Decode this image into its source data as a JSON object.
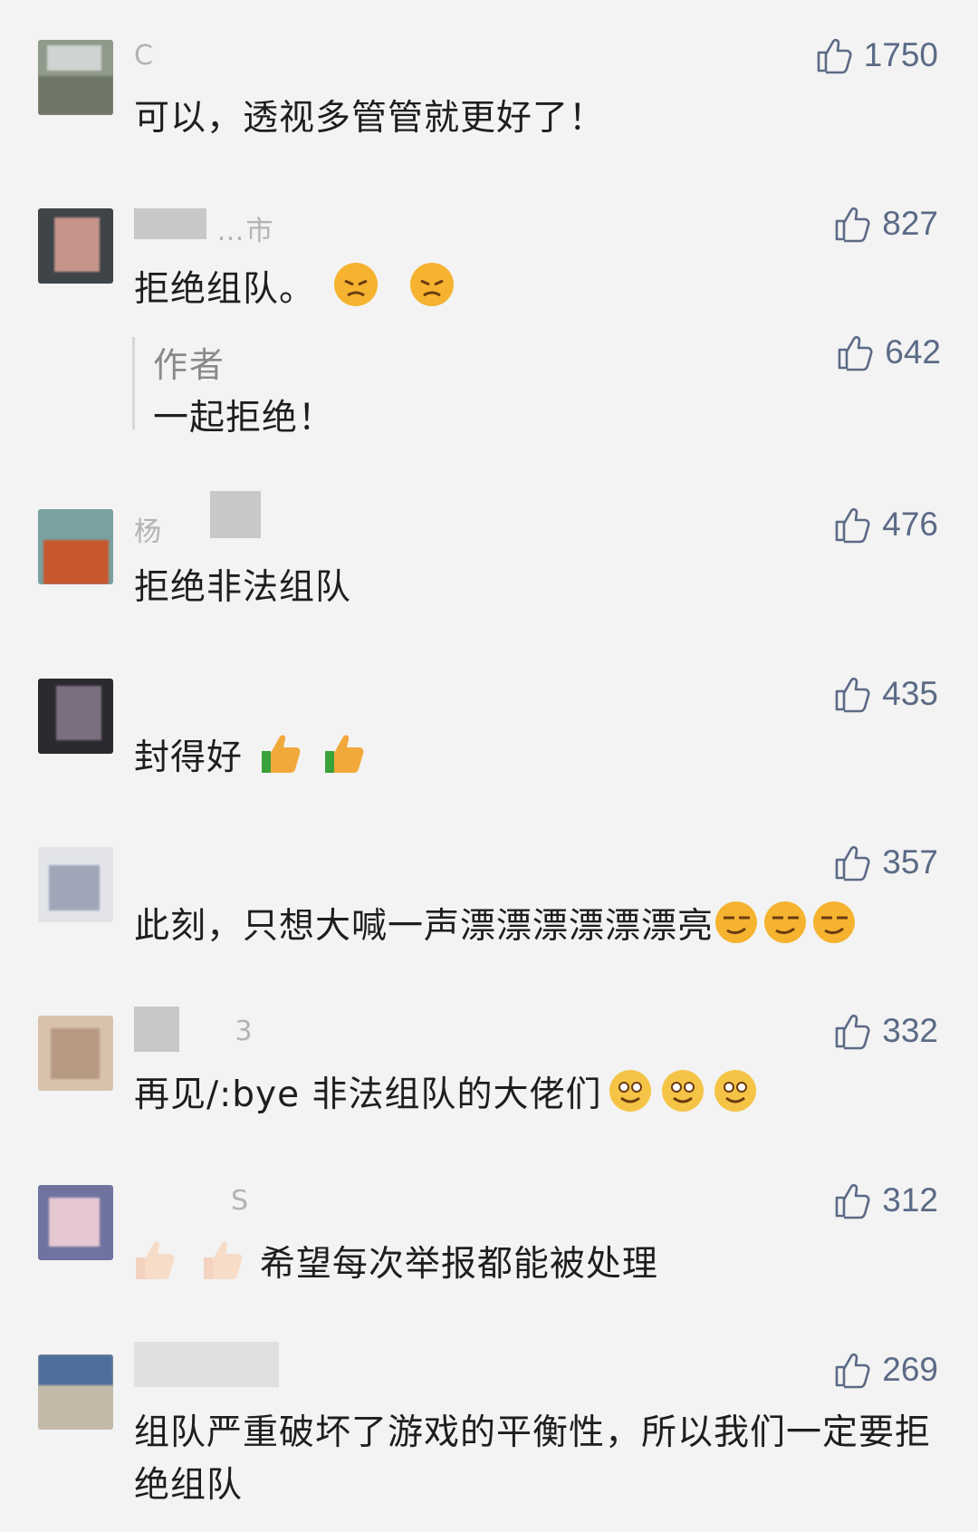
{
  "theme": {
    "background": "#f3f3f3",
    "like_color": "#5b6a86",
    "text_color": "#1e1e1e",
    "name_color": "#b3b3b3"
  },
  "comments": [
    {
      "name": "C",
      "text": "可以，透视多管管就更好了！",
      "likes": "1750",
      "emojis": []
    },
    {
      "name": "…市",
      "text": "拒绝组队。",
      "likes": "827",
      "emojis": [
        "angry-emoji",
        "angry-emoji"
      ],
      "reply": {
        "label": "作者",
        "text": "一起拒绝！",
        "likes": "642"
      }
    },
    {
      "name": "杨",
      "text": "拒绝非法组队",
      "likes": "476",
      "emojis": []
    },
    {
      "name": "",
      "text": "封得好",
      "likes": "435",
      "emojis": [
        "thumbs-up-emoji",
        "thumbs-up-emoji"
      ]
    },
    {
      "name": "",
      "text": "此刻，只想大喊一声漂漂漂漂漂漂亮",
      "likes": "357",
      "emojis": [
        "smirk-emoji",
        "smirk-emoji",
        "smirk-emoji"
      ]
    },
    {
      "name": "3",
      "text": "再见/:bye 非法组队的大佬们",
      "likes": "332",
      "emojis": [
        "smile-emoji",
        "smile-emoji",
        "smile-emoji"
      ]
    },
    {
      "name": "S",
      "text": "希望每次举报都能被处理",
      "likes": "312",
      "emojis": []
    },
    {
      "name": "",
      "text": "组队严重破坏了游戏的平衡性，所以我们一定要拒绝组队",
      "likes": "269",
      "emojis": []
    }
  ]
}
